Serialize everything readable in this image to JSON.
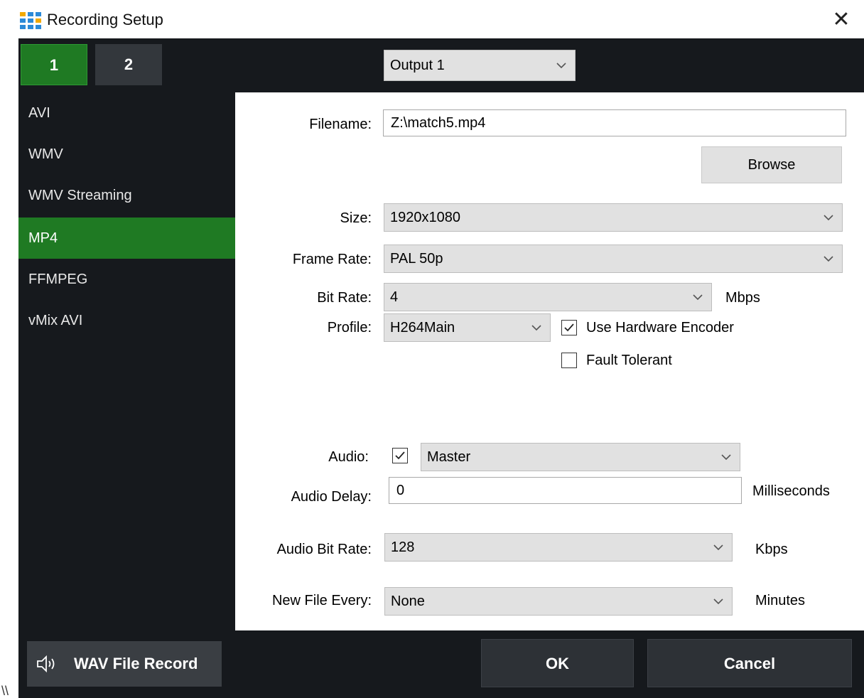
{
  "window": {
    "title": "Recording Setup",
    "close_glyph": "✕"
  },
  "tabs": [
    {
      "label": "1"
    },
    {
      "label": "2"
    }
  ],
  "output_select": {
    "value": "Output 1"
  },
  "sidebar": {
    "items": [
      {
        "label": "AVI"
      },
      {
        "label": "WMV"
      },
      {
        "label": "WMV Streaming"
      },
      {
        "label": "MP4"
      },
      {
        "label": "FFMPEG"
      },
      {
        "label": "vMix AVI"
      }
    ],
    "active": "MP4",
    "wav_button": {
      "label": "WAV File Record"
    }
  },
  "form": {
    "filename": {
      "label": "Filename:",
      "value": "Z:\\match5.mp4"
    },
    "browse_label": "Browse",
    "size": {
      "label": "Size:",
      "value": "1920x1080"
    },
    "frame_rate": {
      "label": "Frame Rate:",
      "value": "PAL 50p"
    },
    "bit_rate": {
      "label": "Bit Rate:",
      "value": "4",
      "unit": "Mbps"
    },
    "profile": {
      "label": "Profile:",
      "value": "H264Main"
    },
    "use_hw_encoder": {
      "label": "Use Hardware Encoder",
      "checked": true
    },
    "fault_tolerant": {
      "label": "Fault Tolerant",
      "checked": false
    },
    "audio": {
      "label": "Audio:",
      "checked": true,
      "value": "Master"
    },
    "audio_delay": {
      "label": "Audio Delay:",
      "value": "0",
      "unit": "Milliseconds"
    },
    "audio_bit_rate": {
      "label": "Audio Bit Rate:",
      "value": "128",
      "unit": "Kbps"
    },
    "new_file_every": {
      "label": "New File Every:",
      "value": "None",
      "unit": "Minutes"
    }
  },
  "footer": {
    "ok_label": "OK",
    "cancel_label": "Cancel"
  },
  "stray_text": "\\\\",
  "colors": {
    "accent_green": "#1f7a23",
    "dark_bg": "#16191d",
    "control_gray": "#e1e1e1"
  }
}
